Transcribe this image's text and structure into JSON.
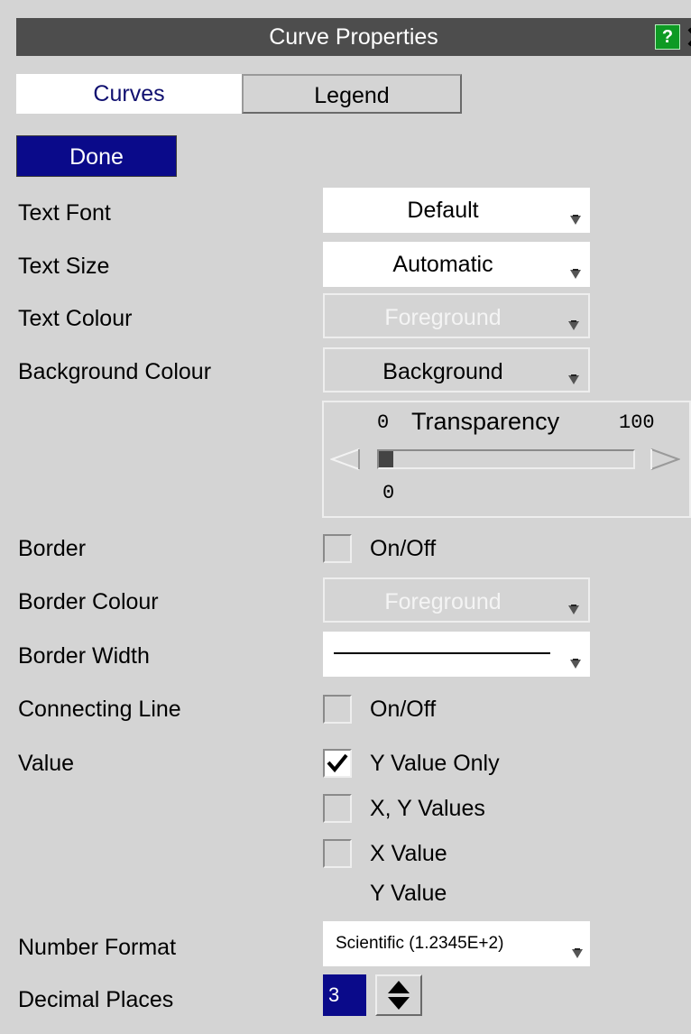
{
  "window": {
    "title": "Curve Properties",
    "help_label": "?"
  },
  "tabs": [
    {
      "label": "Curves",
      "active": true
    },
    {
      "label": "Legend",
      "active": false
    }
  ],
  "done_label": "Done",
  "fields": {
    "text_font": {
      "label": "Text Font",
      "value": "Default"
    },
    "text_size": {
      "label": "Text Size",
      "value": "Automatic"
    },
    "text_colour": {
      "label": "Text Colour",
      "value": "Foreground",
      "enabled": false
    },
    "background_colour": {
      "label": "Background Colour",
      "value": "Background"
    },
    "transparency": {
      "title": "Transparency",
      "min": "0",
      "max": "100",
      "value": "0",
      "level": 0
    },
    "border": {
      "label": "Border",
      "option": "On/Off",
      "checked": false
    },
    "border_colour": {
      "label": "Border Colour",
      "value": "Foreground",
      "enabled": false
    },
    "border_width": {
      "label": "Border Width"
    },
    "connecting_line": {
      "label": "Connecting Line",
      "option": "On/Off",
      "checked": false
    },
    "value": {
      "label": "Value",
      "options": [
        {
          "label": "Y Value Only",
          "checked": true
        },
        {
          "label": "X, Y Values",
          "checked": false
        },
        {
          "label": "X Value",
          "label2": "Y Value",
          "checked": false
        }
      ]
    },
    "number_format": {
      "label": "Number Format",
      "value": "Scientific (1.2345E+2)"
    },
    "decimal_places": {
      "label": "Decimal Places",
      "value": "3"
    }
  },
  "colors": {
    "title_bg": "#4d4d4d",
    "panel_bg": "#d4d4d4",
    "accent_navy": "#0a0a8a",
    "help_green": "#0e9a24",
    "active_tab_text": "#101070"
  },
  "icons": [
    "help-icon",
    "close-icon",
    "dropdown-arrow-icon",
    "slider-left-arrow-icon",
    "slider-right-arrow-icon",
    "checkmark-icon",
    "stepper-icon"
  ]
}
